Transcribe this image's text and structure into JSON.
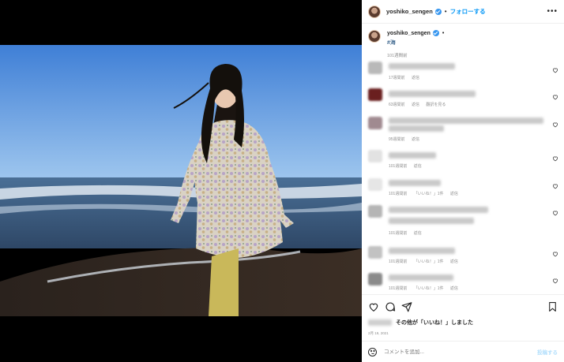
{
  "post": {
    "username": "yoshiko_sengen",
    "follow_label": "フォローする",
    "more_label": "•••",
    "dot": "•",
    "caption_hashtag": "#海",
    "caption_time": "101週間前"
  },
  "comments": [
    {
      "meta": [
        "17週間前",
        "返信"
      ],
      "heart": true
    },
    {
      "meta": [
        "63週間前",
        "返信",
        "翻訳を見る"
      ],
      "heart": true
    },
    {
      "meta": [
        "95週間前",
        "返信"
      ],
      "heart": true
    },
    {
      "meta": [
        "101週間前",
        "返信"
      ],
      "heart": true
    },
    {
      "meta": [
        "101週間前",
        "「いいね！」1件",
        "返信"
      ],
      "heart": true
    },
    {
      "meta": [
        "101週間前",
        "返信"
      ],
      "heart": true
    },
    {
      "meta": [
        "101週間前",
        "「いいね！」1件",
        "返信"
      ],
      "heart": true
    },
    {
      "meta": [
        "101週間前",
        "「いいね！」1件",
        "返信"
      ],
      "heart": true
    }
  ],
  "actions": {
    "likes_text": "その他が「いいね！」しました",
    "date": "2月 19, 2021"
  },
  "composer": {
    "placeholder": "コメントを追加...",
    "post_label": "投稿する"
  },
  "icons": [
    "heart-icon",
    "comment-icon",
    "share-icon",
    "bookmark-icon",
    "emoji-icon",
    "verified-icon",
    "more-icon"
  ]
}
